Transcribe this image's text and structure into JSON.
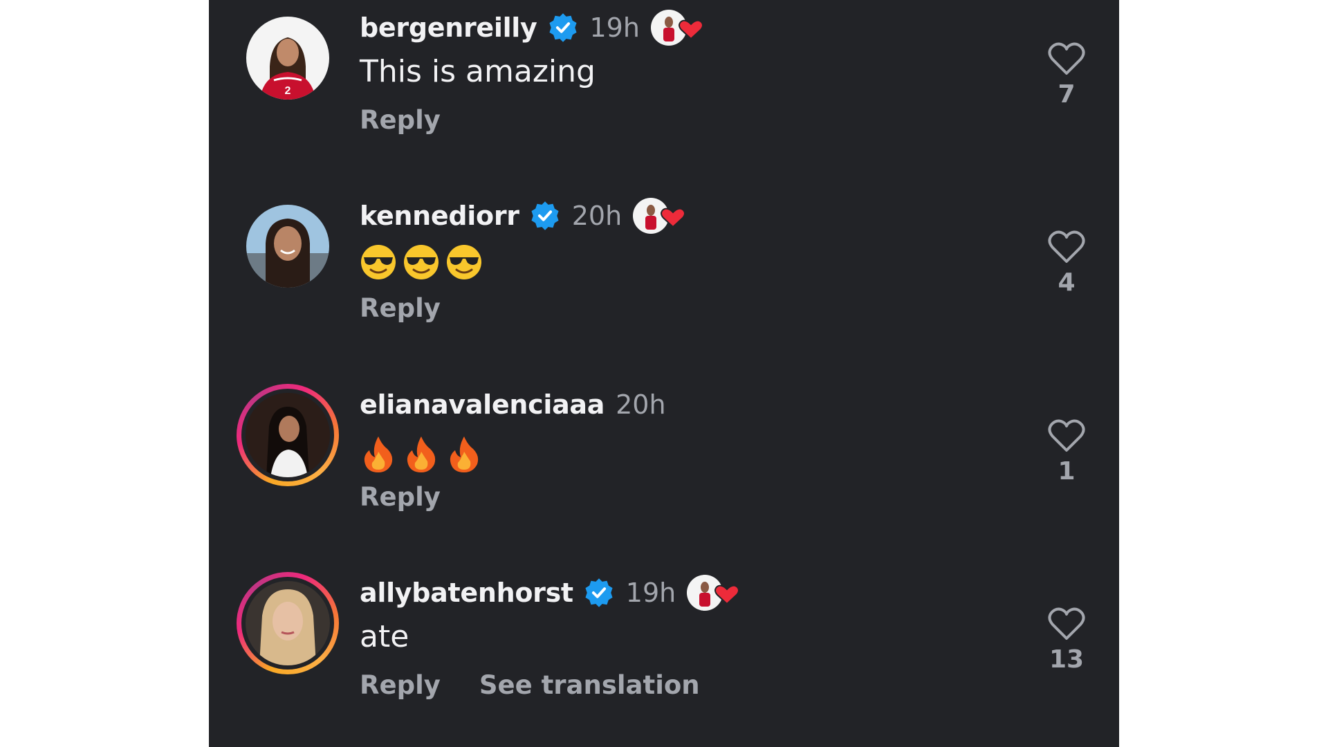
{
  "comments": [
    {
      "username": "bergenreilly",
      "verified": true,
      "time": "19h",
      "text": "This is amazing",
      "emojis": [],
      "reply_label": "Reply",
      "likes": "7",
      "creator_liked": true
    },
    {
      "username": "kennediorr",
      "verified": true,
      "time": "20h",
      "text": "",
      "emojis": [
        "sunglasses-face",
        "sunglasses-face",
        "sunglasses-face"
      ],
      "reply_label": "Reply",
      "likes": "4",
      "creator_liked": true
    },
    {
      "username": "elianavalenciaaa",
      "verified": false,
      "time": "20h",
      "text": "",
      "emojis": [
        "fire",
        "fire",
        "fire"
      ],
      "reply_label": "Reply",
      "likes": "1",
      "creator_liked": false
    },
    {
      "username": "allybatenhorst",
      "verified": true,
      "time": "19h",
      "text": "ate",
      "emojis": [],
      "reply_label": "Reply",
      "translation_label": "See translation",
      "likes": "13",
      "creator_liked": true
    }
  ],
  "colors": {
    "background": "#222327",
    "primary_text": "#f2f2f4",
    "secondary_text": "#a3a6ad",
    "verified_blue": "#1d9bf0",
    "heart_red": "#ed2b3a"
  }
}
